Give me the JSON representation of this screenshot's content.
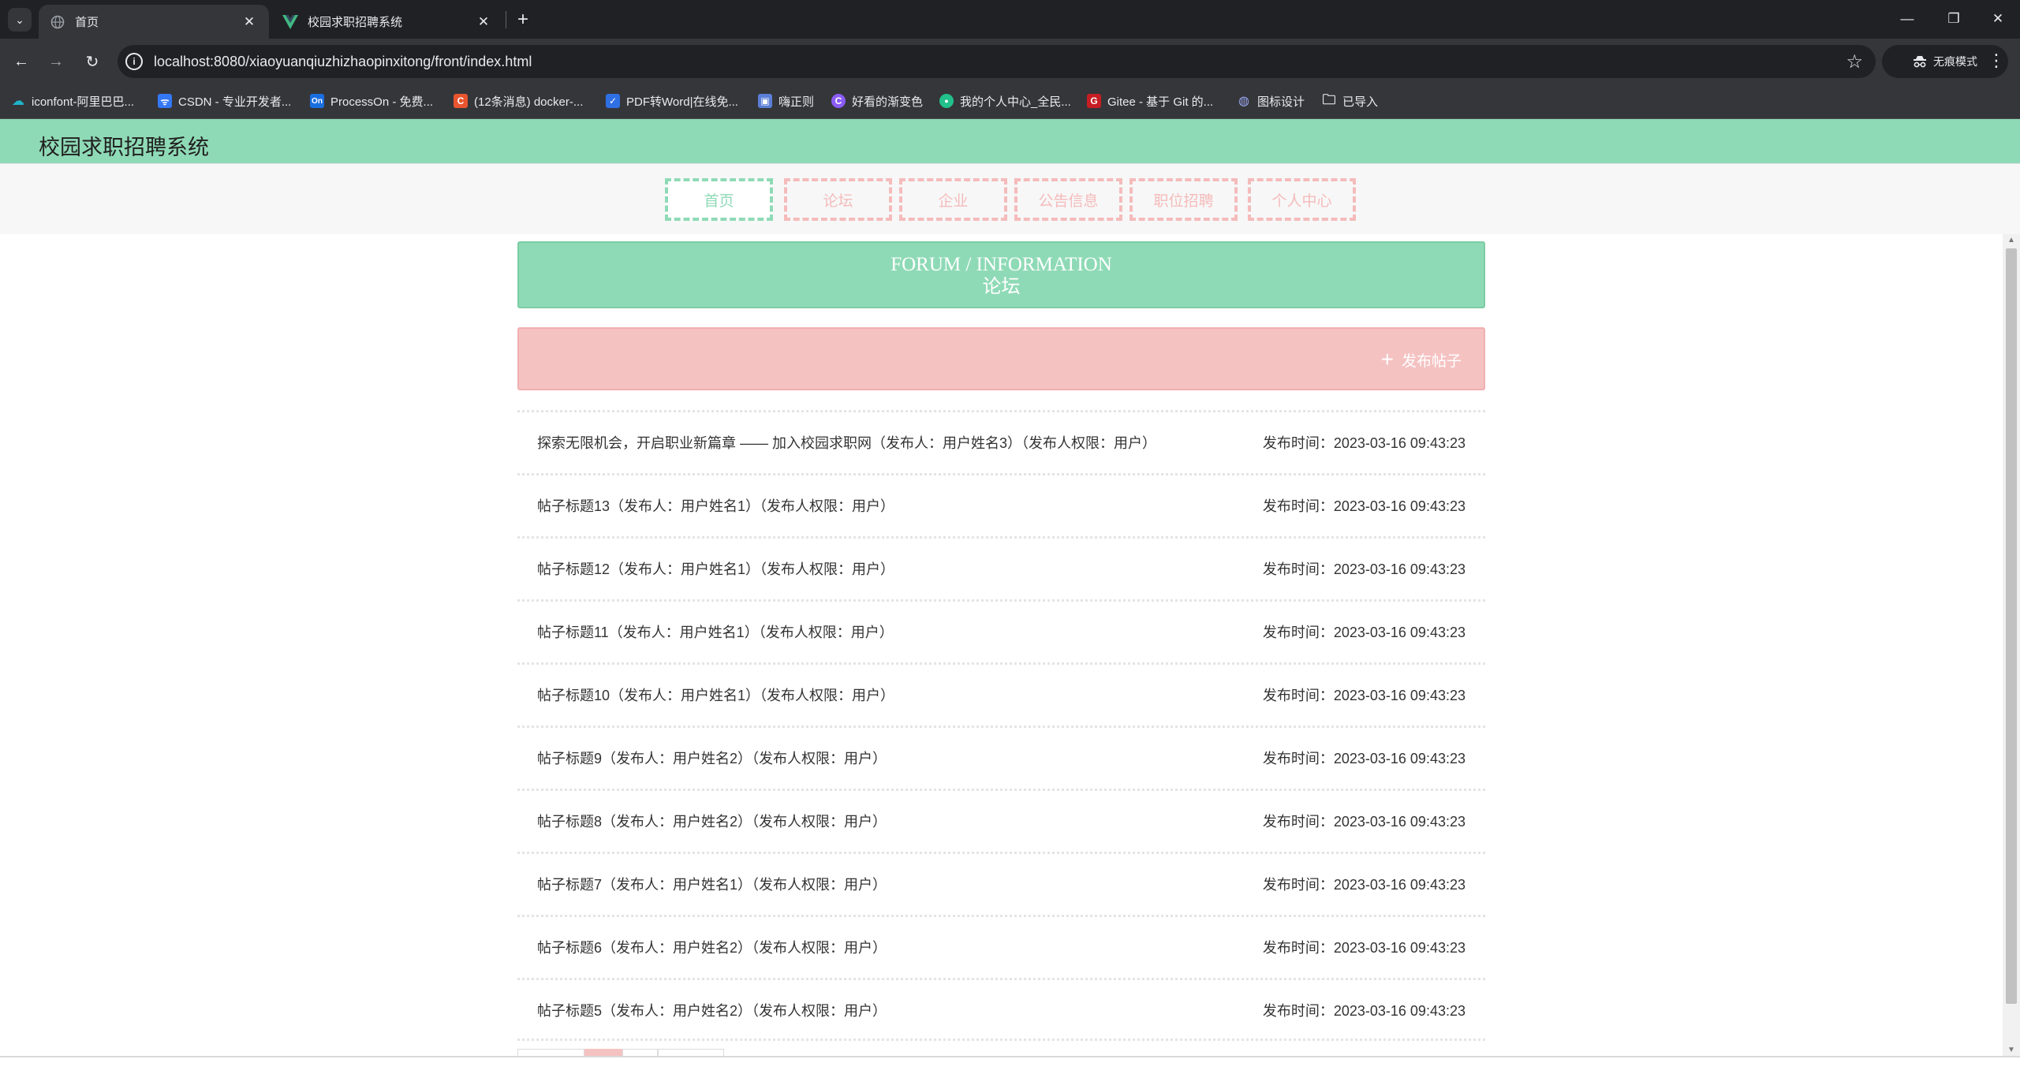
{
  "browser": {
    "tabs": [
      {
        "title": "首页",
        "active": true
      },
      {
        "title": "校园求职招聘系统",
        "active": false
      }
    ],
    "new_tab": "+",
    "url": "localhost:8080/xiaoyuanqiuzhizhaopinxitong/front/index.html",
    "incognito_label": "无痕模式",
    "window_controls": {
      "minimize": "—",
      "restore": "❐",
      "close": "✕"
    },
    "bookmarks": [
      {
        "label": "iconfont-阿里巴巴...",
        "icon": "iconfont-icon",
        "color": "#1fb4c9",
        "glyph": "☁"
      },
      {
        "label": "CSDN - 专业开发者...",
        "icon": "csdn-icon",
        "color": "#3478f6",
        "glyph": "ᯤ"
      },
      {
        "label": "ProcessOn - 免费...",
        "icon": "processon-icon",
        "color": "#1a6fe0",
        "glyph": "On"
      },
      {
        "label": "(12条消息) docker-...",
        "icon": "csdn-c-icon",
        "color": "#e8552e",
        "glyph": "C"
      },
      {
        "label": "PDF转Word|在线免...",
        "icon": "pdf-icon",
        "color": "#2f6fe4",
        "glyph": "✓"
      },
      {
        "label": "嗨正则",
        "icon": "regex-icon",
        "color": "#5b7fd6",
        "glyph": "▣"
      },
      {
        "label": "好看的渐变色",
        "icon": "gradient-icon",
        "color": "#8b5cf6",
        "glyph": "C"
      },
      {
        "label": "我的个人中心_全民...",
        "icon": "profile-icon",
        "color": "#22c08a",
        "glyph": "●"
      },
      {
        "label": "Gitee - 基于 Git 的...",
        "icon": "gitee-icon",
        "color": "#c71d23",
        "glyph": "G"
      },
      {
        "label": "图标设计",
        "icon": "design-icon",
        "color": "#6f7de8",
        "glyph": "◍"
      },
      {
        "label": "已导入",
        "icon": "folder-icon",
        "color": "#35363a",
        "glyph": "🗀"
      }
    ]
  },
  "site": {
    "title": "校园求职招聘系统",
    "nav": [
      {
        "label": "首页",
        "active": true
      },
      {
        "label": "论坛",
        "active": false
      },
      {
        "label": "企业",
        "active": false
      },
      {
        "label": "公告信息",
        "active": false
      },
      {
        "label": "职位招聘",
        "active": false
      },
      {
        "label": "个人中心",
        "active": false
      }
    ],
    "banner": {
      "en": "FORUM / INFORMATION",
      "cn": "论坛"
    },
    "post_button": {
      "icon": "+",
      "label": "发布帖子"
    },
    "posts": [
      {
        "title": "探索无限机会，开启职业新篇章 —— 加入校园求职网（发布人：用户姓名3）（发布人权限：用户）",
        "date": "发布时间：2023-03-16 09:43:23"
      },
      {
        "title": "帖子标题13（发布人：用户姓名1）（发布人权限：用户）",
        "date": "发布时间：2023-03-16 09:43:23"
      },
      {
        "title": "帖子标题12（发布人：用户姓名1）（发布人权限：用户）",
        "date": "发布时间：2023-03-16 09:43:23"
      },
      {
        "title": "帖子标题11（发布人：用户姓名1）（发布人权限：用户）",
        "date": "发布时间：2023-03-16 09:43:23"
      },
      {
        "title": "帖子标题10（发布人：用户姓名1）（发布人权限：用户）",
        "date": "发布时间：2023-03-16 09:43:23"
      },
      {
        "title": "帖子标题9（发布人：用户姓名2）（发布人权限：用户）",
        "date": "发布时间：2023-03-16 09:43:23"
      },
      {
        "title": "帖子标题8（发布人：用户姓名2）（发布人权限：用户）",
        "date": "发布时间：2023-03-16 09:43:23"
      },
      {
        "title": "帖子标题7（发布人：用户姓名1）（发布人权限：用户）",
        "date": "发布时间：2023-03-16 09:43:23"
      },
      {
        "title": "帖子标题6（发布人：用户姓名2）（发布人权限：用户）",
        "date": "发布时间：2023-03-16 09:43:23"
      },
      {
        "title": "帖子标题5（发布人：用户姓名2）（发布人权限：用户）",
        "date": "发布时间：2023-03-16 09:43:23"
      }
    ]
  },
  "colors": {
    "accent_green": "#8fdab6",
    "accent_pink": "#f5bbbb",
    "chrome_dark": "#202124",
    "chrome_mid": "#35363a"
  }
}
